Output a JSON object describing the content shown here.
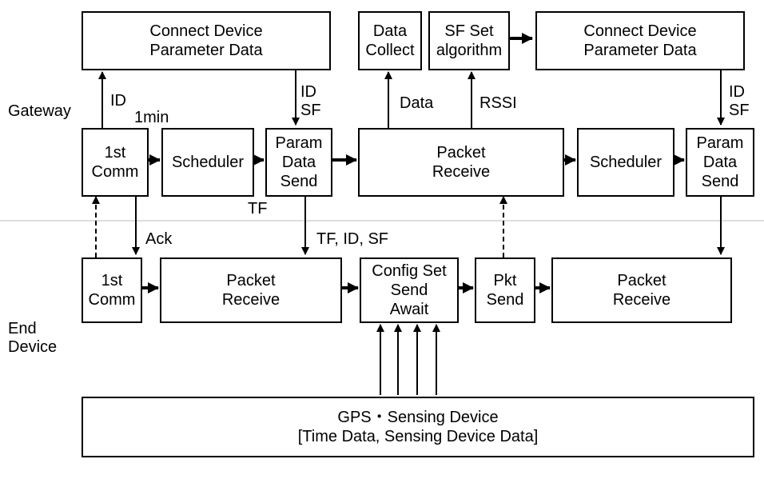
{
  "labels": {
    "gateway": "Gateway",
    "end_device": "End\nDevice",
    "id_up": "ID",
    "one_min": "1min",
    "id_sf_1": "ID\nSF",
    "tf": "TF",
    "ack": "Ack",
    "tf_id_sf": "TF, ID, SF",
    "data": "Data",
    "rssi": "RSSI",
    "id_sf_2": "ID\nSF"
  },
  "boxes": {
    "cdpd1": "Connect Device\nParameter Data",
    "data_collect": "Data\nCollect",
    "sf_set": "SF Set\nalgorithm",
    "cdpd2": "Connect Device\nParameter Data",
    "first_comm_gw": "1st\nComm",
    "scheduler1": "Scheduler",
    "param_send1": "Param\nData\nSend",
    "packet_receive_gw": "Packet\nReceive",
    "scheduler2": "Scheduler",
    "param_send2": "Param\nData\nSend",
    "first_comm_ed": "1st\nComm",
    "packet_receive_ed1": "Packet\nReceive",
    "config_set": "Config Set\nSend\nAwait",
    "pkt_send": "Pkt\nSend",
    "packet_receive_ed2": "Packet\nReceive",
    "gps": "GPS・Sensing Device\n[Time Data, Sensing Device Data]"
  }
}
